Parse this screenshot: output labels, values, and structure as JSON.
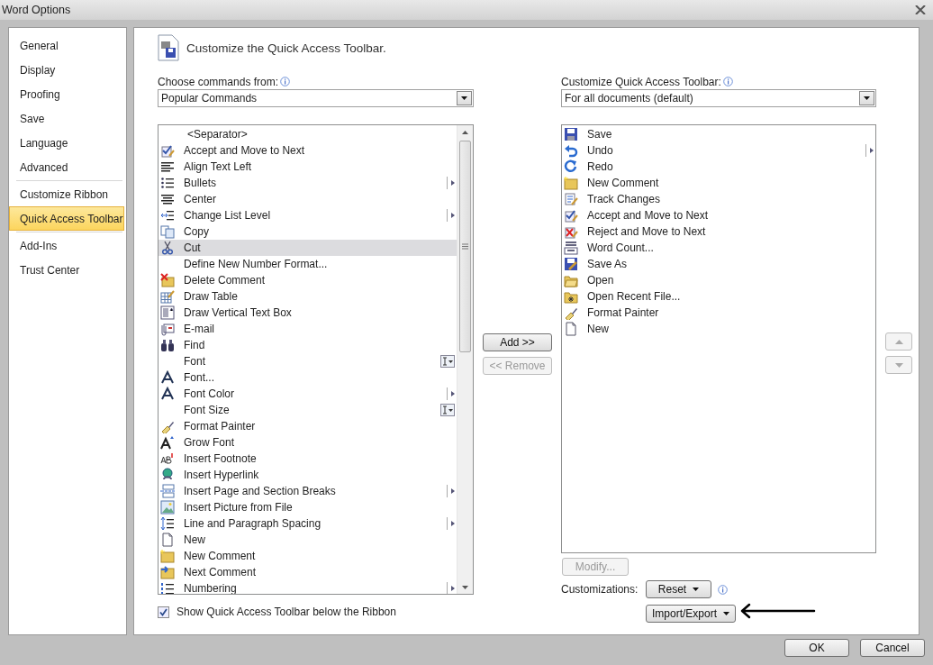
{
  "window": {
    "title": "Word Options"
  },
  "sidebar": {
    "items": [
      {
        "label": "General",
        "selected": false,
        "divider_before": false
      },
      {
        "label": "Display",
        "selected": false,
        "divider_before": false
      },
      {
        "label": "Proofing",
        "selected": false,
        "divider_before": false
      },
      {
        "label": "Save",
        "selected": false,
        "divider_before": false
      },
      {
        "label": "Language",
        "selected": false,
        "divider_before": false
      },
      {
        "label": "Advanced",
        "selected": false,
        "divider_before": false
      },
      {
        "label": "Customize Ribbon",
        "selected": false,
        "divider_before": true
      },
      {
        "label": "Quick Access Toolbar",
        "selected": true,
        "divider_before": false
      },
      {
        "label": "Add-Ins",
        "selected": false,
        "divider_before": true
      },
      {
        "label": "Trust Center",
        "selected": false,
        "divider_before": false
      }
    ]
  },
  "header": {
    "title": "Customize the Quick Access Toolbar."
  },
  "commands": {
    "label": "Choose commands from:",
    "dropdown": "Popular Commands",
    "items": [
      {
        "label": "<Separator>",
        "kind": "separator",
        "selected": false
      },
      {
        "label": "Accept and Move to Next",
        "kind": "plain",
        "selected": false
      },
      {
        "label": "Align Text Left",
        "kind": "plain",
        "selected": false
      },
      {
        "label": "Bullets",
        "kind": "submenu",
        "selected": false
      },
      {
        "label": "Center",
        "kind": "plain",
        "selected": false
      },
      {
        "label": "Change List Level",
        "kind": "submenu",
        "selected": false
      },
      {
        "label": "Copy",
        "kind": "plain",
        "selected": false
      },
      {
        "label": "Cut",
        "kind": "plain",
        "selected": true
      },
      {
        "label": "Define New Number Format...",
        "kind": "plain",
        "selected": false
      },
      {
        "label": "Delete Comment",
        "kind": "plain",
        "selected": false
      },
      {
        "label": "Draw Table",
        "kind": "plain",
        "selected": false
      },
      {
        "label": "Draw Vertical Text Box",
        "kind": "plain",
        "selected": false
      },
      {
        "label": "E-mail",
        "kind": "plain",
        "selected": false
      },
      {
        "label": "Find",
        "kind": "plain",
        "selected": false
      },
      {
        "label": "Font",
        "kind": "combo",
        "selected": false
      },
      {
        "label": "Font...",
        "kind": "plain",
        "selected": false
      },
      {
        "label": "Font Color",
        "kind": "submenu",
        "selected": false
      },
      {
        "label": "Font Size",
        "kind": "combo",
        "selected": false
      },
      {
        "label": "Format Painter",
        "kind": "plain",
        "selected": false
      },
      {
        "label": "Grow Font",
        "kind": "plain",
        "selected": false
      },
      {
        "label": "Insert Footnote",
        "kind": "plain",
        "selected": false
      },
      {
        "label": "Insert Hyperlink",
        "kind": "plain",
        "selected": false
      },
      {
        "label": "Insert Page and Section Breaks",
        "kind": "submenu",
        "selected": false
      },
      {
        "label": "Insert Picture from File",
        "kind": "plain",
        "selected": false
      },
      {
        "label": "Line and Paragraph Spacing",
        "kind": "submenu",
        "selected": false
      },
      {
        "label": "New",
        "kind": "plain",
        "selected": false
      },
      {
        "label": "New Comment",
        "kind": "plain",
        "selected": false
      },
      {
        "label": "Next Comment",
        "kind": "plain",
        "selected": false
      },
      {
        "label": "Numbering",
        "kind": "submenu",
        "selected": false
      }
    ],
    "checkbox": {
      "label": "Show Quick Access Toolbar below the Ribbon",
      "checked": true
    }
  },
  "middle_buttons": [
    {
      "label": "Add >>",
      "disabled": false
    },
    {
      "label": "<< Remove",
      "disabled": true
    }
  ],
  "toolbar": {
    "label": "Customize Quick Access Toolbar:",
    "dropdown": "For all documents (default)",
    "items": [
      {
        "label": "Save",
        "kind": "plain"
      },
      {
        "label": "Undo",
        "kind": "submenu"
      },
      {
        "label": "Redo",
        "kind": "plain"
      },
      {
        "label": "New Comment",
        "kind": "plain"
      },
      {
        "label": "Track Changes",
        "kind": "plain"
      },
      {
        "label": "Accept and Move to Next",
        "kind": "plain"
      },
      {
        "label": "Reject and Move to Next",
        "kind": "plain"
      },
      {
        "label": "Word Count...",
        "kind": "plain"
      },
      {
        "label": "Save As",
        "kind": "plain"
      },
      {
        "label": "Open",
        "kind": "plain"
      },
      {
        "label": "Open Recent File...",
        "kind": "plain"
      },
      {
        "label": "Format Painter",
        "kind": "plain"
      },
      {
        "label": "New",
        "kind": "plain"
      }
    ],
    "modify": {
      "label": "Modify...",
      "disabled": true
    },
    "customizations_label": "Customizations:",
    "reset": {
      "label": "Reset"
    },
    "import_export": {
      "label": "Import/Export"
    }
  },
  "footer_buttons": [
    "OK",
    "Cancel"
  ]
}
